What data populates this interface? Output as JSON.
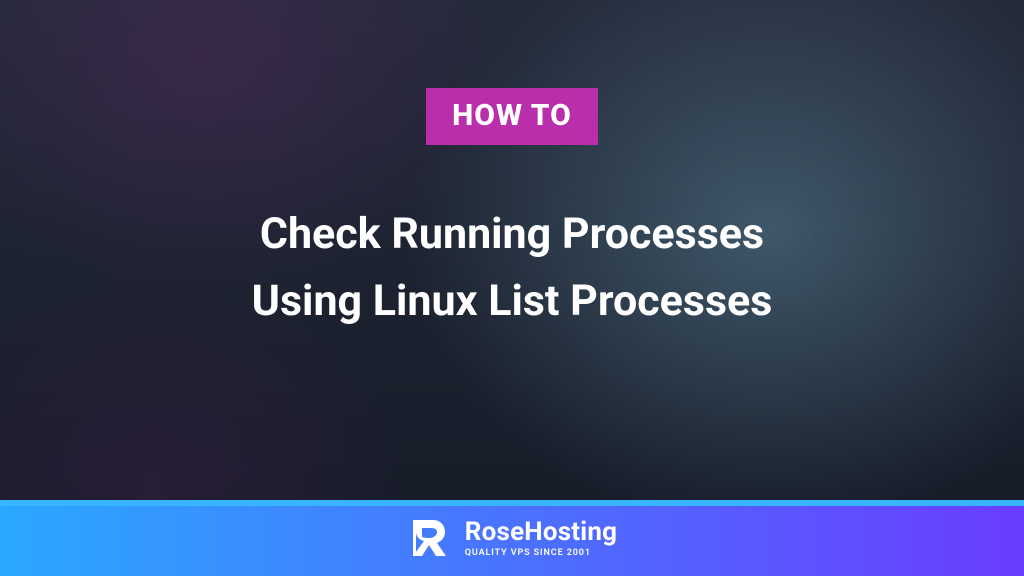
{
  "colors": {
    "badge_bg": "#b82eab",
    "footer_gradient_from": "#2aa8ff",
    "footer_gradient_to": "#6a3cff",
    "divider": "#39b4ff"
  },
  "badge": {
    "label": "HOW TO"
  },
  "title": {
    "line1": "Check Running Processes",
    "line2": "Using Linux List Processes"
  },
  "brand": {
    "name": "RoseHosting",
    "tagline": "QUALITY VPS SINCE 2001"
  }
}
